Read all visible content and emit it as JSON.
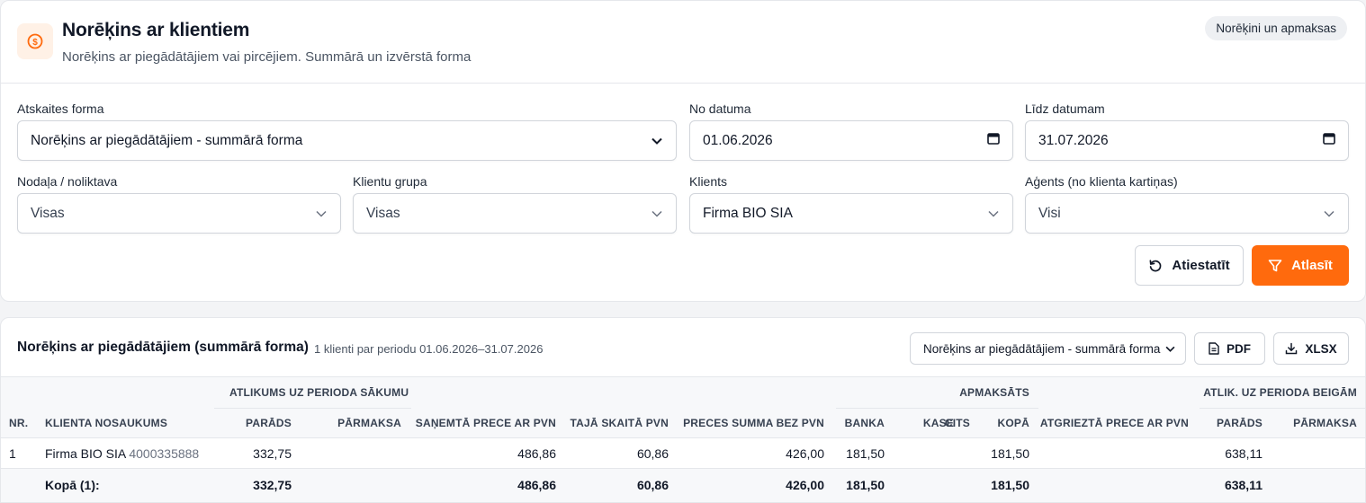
{
  "header": {
    "title": "Norēķins ar klientiem",
    "subtitle": "Norēķins ar piegādātājiem vai pircējiem. Summārā un izvērstā forma",
    "badge": "Norēķini un apmaksas"
  },
  "filters": {
    "report_form": {
      "label": "Atskaites forma",
      "value": "Norēķins ar piegādātājiem - summārā forma"
    },
    "date_from": {
      "label": "No datuma",
      "value": "01.06.2026"
    },
    "date_to": {
      "label": "Līdz datumam",
      "value": "31.07.2026"
    },
    "department": {
      "label": "Nodaļa / noliktava",
      "value": "Visas"
    },
    "client_group": {
      "label": "Klientu grupa",
      "value": "Visas"
    },
    "client": {
      "label": "Klients",
      "value": "Firma BIO SIA"
    },
    "agent": {
      "label": "Aģents (no klienta kartiņas)",
      "value": "Visi"
    },
    "reset_label": "Atiestatīt",
    "apply_label": "Atlasīt"
  },
  "results": {
    "title": "Norēķins ar piegādātājiem (summārā forma)",
    "subtitle": "1 klienti par periodu 01.06.2026–31.07.2026",
    "form_select": "Norēķins ar piegādātājiem - summārā forma",
    "pdf_label": "PDF",
    "xlsx_label": "XLSX",
    "groups": {
      "opening": "ATLIKUMS UZ PERIODA SĀKUMU",
      "paid": "APMAKSĀTS",
      "closing": "ATLIK. UZ PERIODA BEIGĀM"
    },
    "columns": {
      "nr": "NR.",
      "name": "KLIENTA NOSAUKUMS",
      "open_debt": "PARĀDS",
      "open_over": "PĀRMAKSA",
      "received": "SAŅEMTĀ PRECE AR PVN",
      "vat": "TAJĀ SKAITĀ PVN",
      "net": "PRECES SUMMA BEZ PVN",
      "bank": "BANKA",
      "cash": "KASE",
      "other": "CITS",
      "total": "KOPĀ",
      "returned": "ATGRIEZTĀ PRECE AR PVN",
      "close_debt": "PARĀDS",
      "close_over": "PĀRMAKSA"
    },
    "row": {
      "nr": "1",
      "name": "Firma BIO SIA",
      "code": "4000335888",
      "open_debt": "332,75",
      "received": "486,86",
      "vat": "60,86",
      "net": "426,00",
      "bank": "181,50",
      "total": "181,50",
      "close_debt": "638,11"
    },
    "totals": {
      "label": "Kopā (1):",
      "open_debt": "332,75",
      "received": "486,86",
      "vat": "60,86",
      "net": "426,00",
      "bank": "181,50",
      "total": "181,50",
      "close_debt": "638,11"
    }
  },
  "colors": {
    "accent": "#ff6a0d",
    "accent_soft": "#fff1e6"
  }
}
